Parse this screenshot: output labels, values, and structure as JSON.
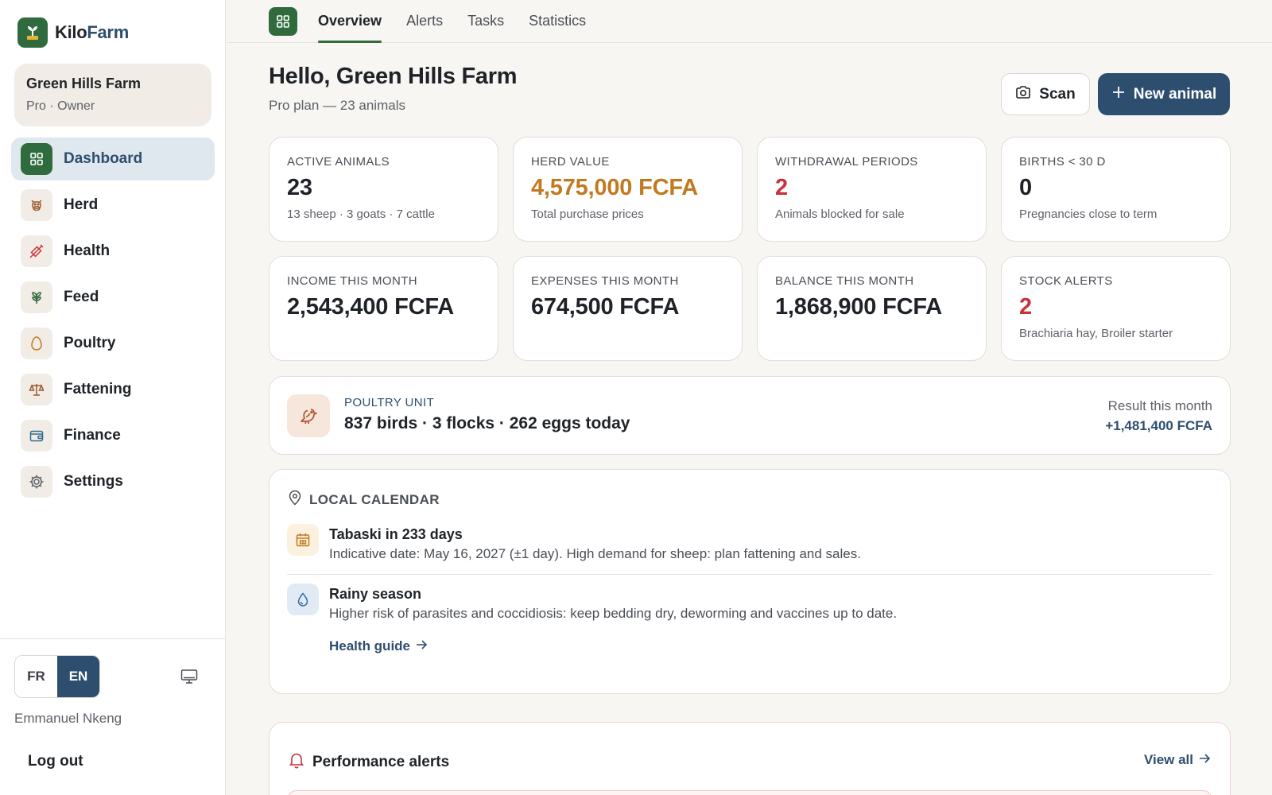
{
  "brand": {
    "name_a": "Kilo",
    "name_b": "Farm"
  },
  "farm": {
    "name": "Green Hills Farm",
    "plan": "Pro · Owner"
  },
  "nav": [
    {
      "label": "Dashboard",
      "icon": "grid-icon",
      "active": true
    },
    {
      "label": "Herd",
      "icon": "cow-icon"
    },
    {
      "label": "Health",
      "icon": "syringe-icon"
    },
    {
      "label": "Feed",
      "icon": "grain-icon"
    },
    {
      "label": "Poultry",
      "icon": "egg-icon"
    },
    {
      "label": "Fattening",
      "icon": "scale-icon"
    },
    {
      "label": "Finance",
      "icon": "wallet-icon"
    },
    {
      "label": "Settings",
      "icon": "gear-icon"
    }
  ],
  "language": {
    "fr": "FR",
    "en": "EN",
    "selected": "EN"
  },
  "user": {
    "name": "Emmanuel Nkeng",
    "logout": "Log out"
  },
  "tabs": [
    {
      "label": "Overview",
      "active": true
    },
    {
      "label": "Alerts"
    },
    {
      "label": "Tasks"
    },
    {
      "label": "Statistics"
    }
  ],
  "header": {
    "greeting": "Hello, Green Hills Farm",
    "plan_line": "Pro plan — 23 animals",
    "scan_label": "Scan",
    "new_animal_label": "New animal"
  },
  "stats": [
    {
      "label": "ACTIVE ANIMALS",
      "value": "23",
      "sub": "13 sheep · 3 goats · 7 cattle",
      "tone": "default"
    },
    {
      "label": "HERD VALUE",
      "value": "4,575,000 FCFA",
      "sub": "Total purchase prices",
      "tone": "orange"
    },
    {
      "label": "WITHDRAWAL PERIODS",
      "value": "2",
      "sub": "Animals blocked for sale",
      "tone": "red"
    },
    {
      "label": "BIRTHS < 30 D",
      "value": "0",
      "sub": "Pregnancies close to term",
      "tone": "default"
    },
    {
      "label": "INCOME THIS MONTH",
      "value": "2,543,400 FCFA",
      "sub": "",
      "tone": "default"
    },
    {
      "label": "EXPENSES THIS MONTH",
      "value": "674,500 FCFA",
      "sub": "",
      "tone": "default"
    },
    {
      "label": "BALANCE THIS MONTH",
      "value": "1,868,900 FCFA",
      "sub": "",
      "tone": "default"
    },
    {
      "label": "STOCK ALERTS",
      "value": "2",
      "sub": "Brachiaria hay, Broiler starter",
      "tone": "red"
    }
  ],
  "poultry": {
    "label": "POULTRY UNIT",
    "stats": "837 birds · 3 flocks · 262 eggs today",
    "result_label": "Result this month",
    "result_value": "+1,481,400 FCFA"
  },
  "calendar": {
    "heading": "LOCAL CALENDAR",
    "items": [
      {
        "title": "Tabaski in 233 days",
        "text": "Indicative date: May 16, 2027 (±1 day). High demand for sheep: plan fattening and sales.",
        "icon": "calendar-icon"
      },
      {
        "title": "Rainy season",
        "text": "Higher risk of parasites and coccidiosis: keep bedding dry, deworming and vaccines up to date.",
        "icon": "water-drop-icon"
      }
    ],
    "link": "Health guide"
  },
  "alerts": {
    "heading": "Performance alerts",
    "view_all": "View all"
  },
  "colors": {
    "primary_green": "#2f6b3d",
    "navy": "#2e4e6f",
    "orange": "#c27a20",
    "red": "#c8323a"
  }
}
